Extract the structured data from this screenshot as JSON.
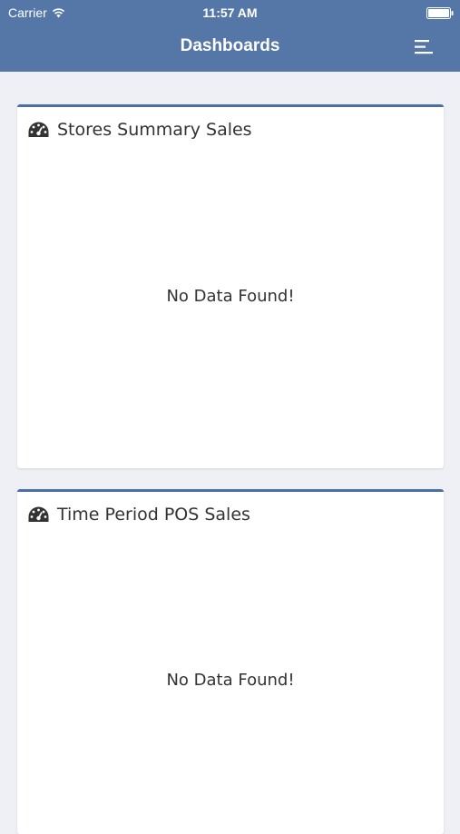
{
  "status_bar": {
    "carrier": "Carrier",
    "time": "11:57 AM"
  },
  "nav": {
    "title": "Dashboards"
  },
  "cards": [
    {
      "title": "Stores Summary Sales",
      "icon": "dashboard-gauge-icon",
      "empty_message": "No Data Found!"
    },
    {
      "title": "Time Period POS Sales",
      "icon": "dashboard-gauge-icon",
      "empty_message": "No Data Found!"
    }
  ],
  "colors": {
    "header": "#5577a8",
    "card_accent": "#4a6fa8",
    "background": "#eef0f5"
  }
}
